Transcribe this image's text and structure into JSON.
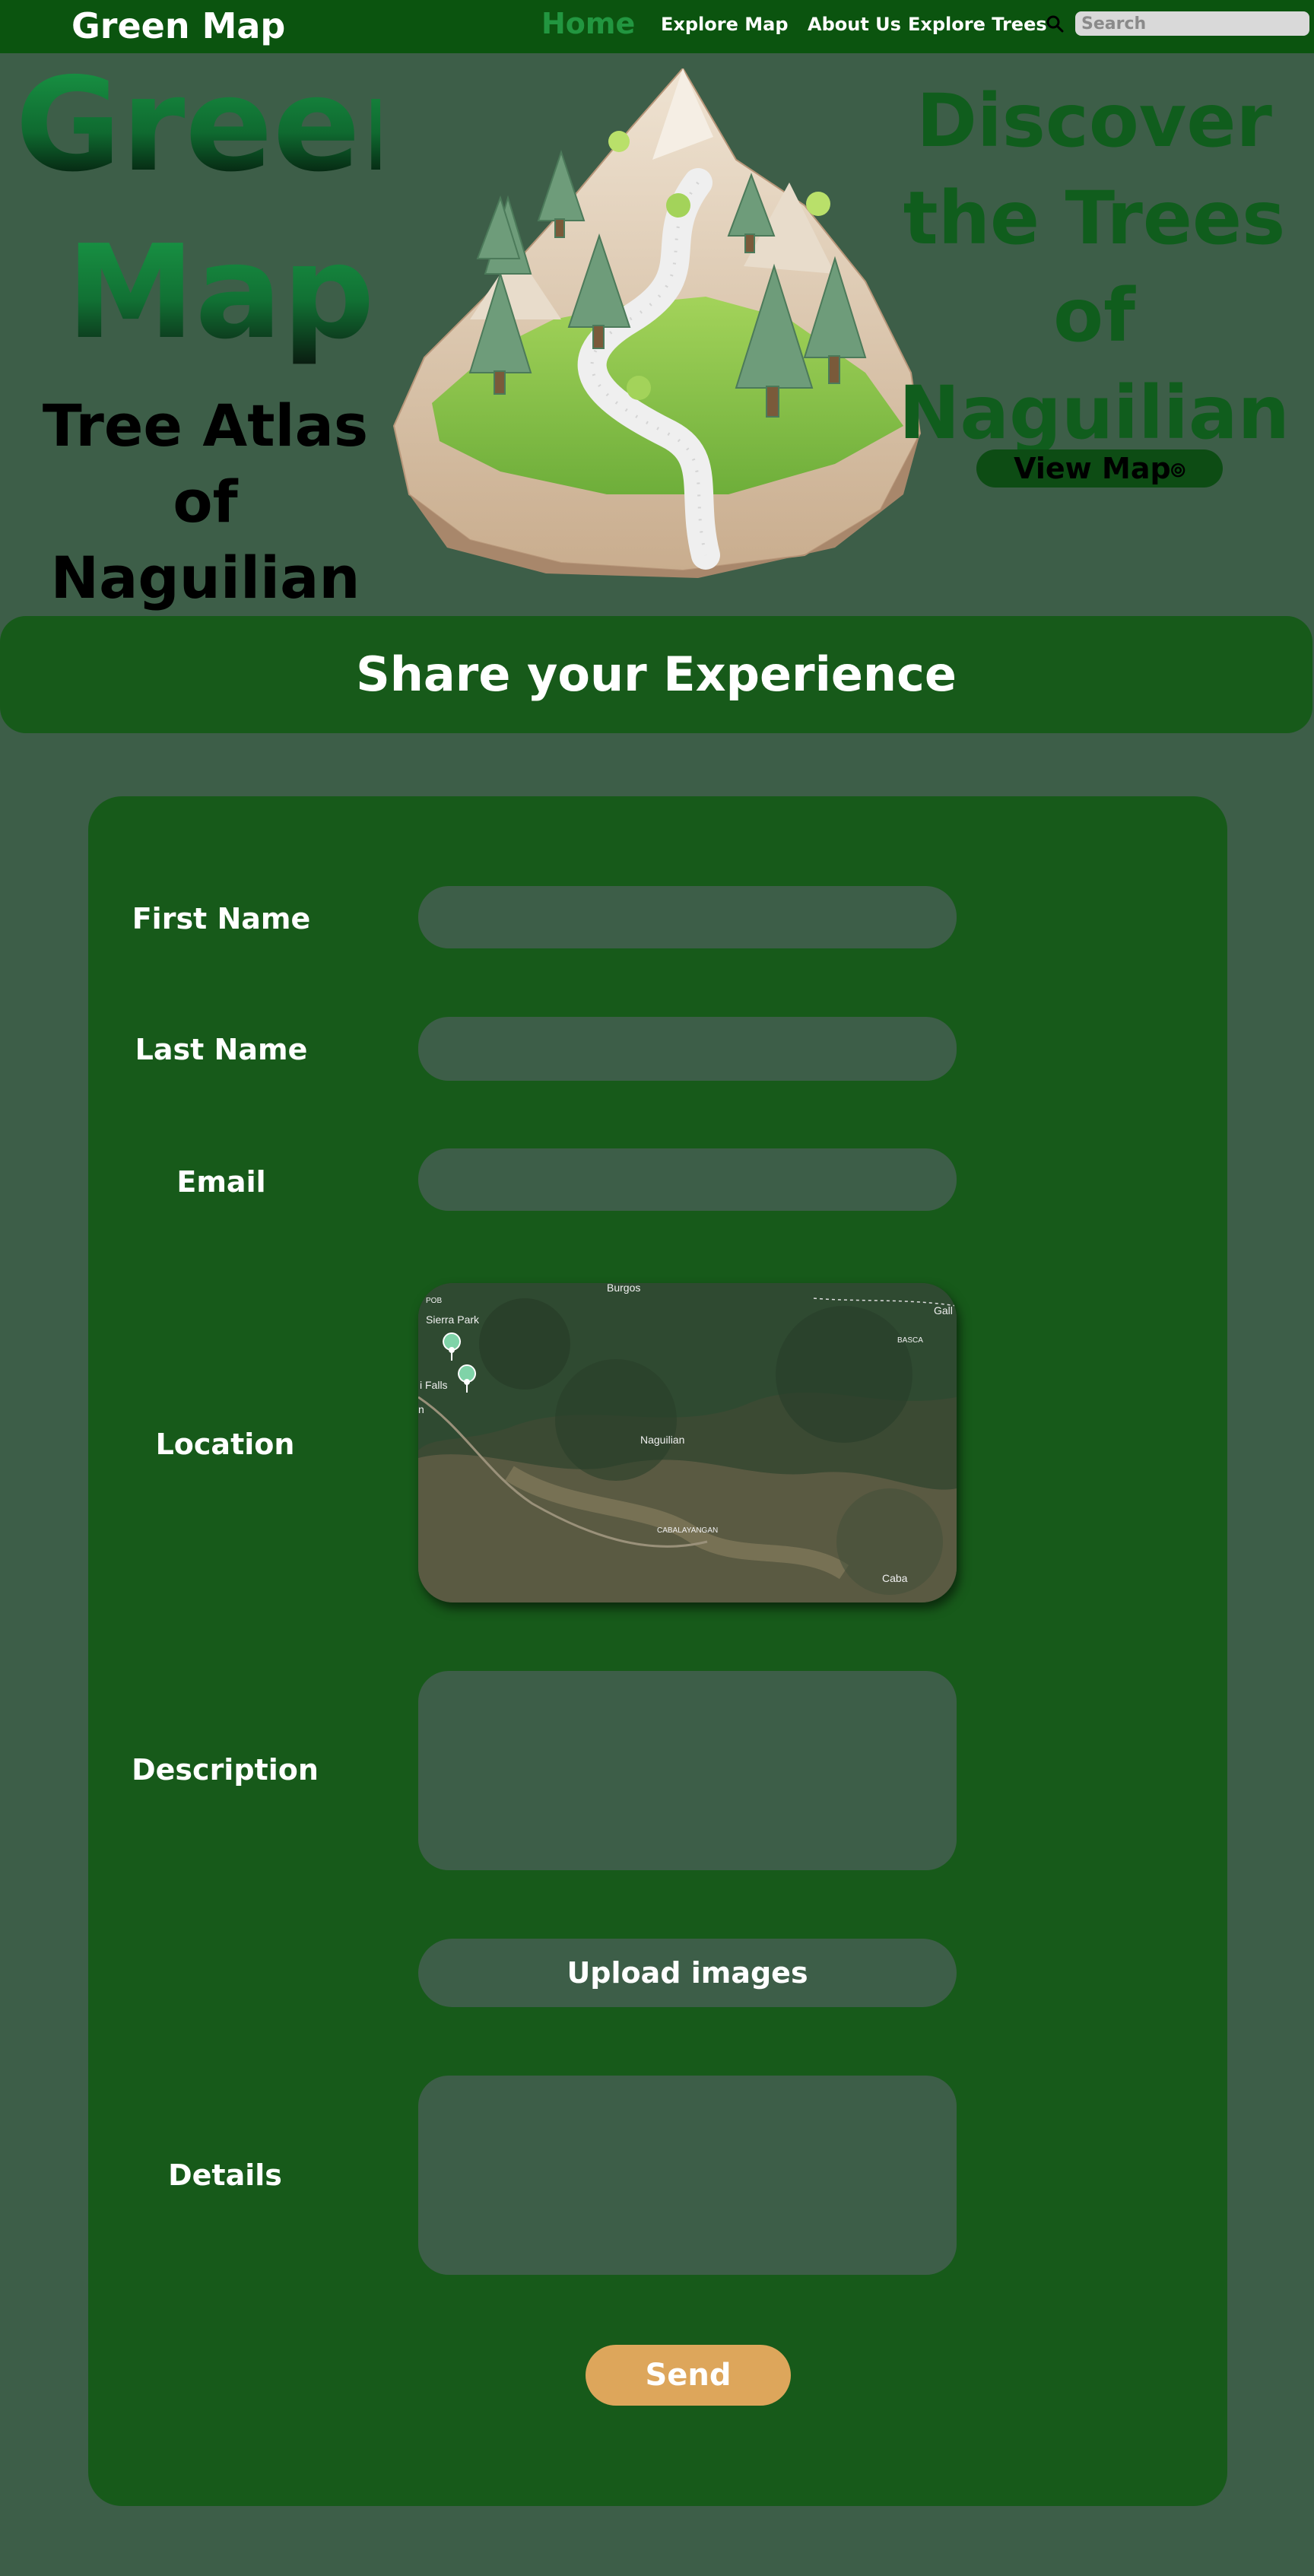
{
  "nav": {
    "brand": "Green Map",
    "home": "Home",
    "explore_map": "Explore Map",
    "about_us": "About Us",
    "explore_trees": "Explore Trees",
    "search_placeholder": "Search",
    "search_icon": "search-icon"
  },
  "hero": {
    "title_line1": "Green",
    "title_line2": "Map",
    "subtitle": "Tree Atlas of Naguilian",
    "discover": "Discover the Trees of Naguilian",
    "view_map_label": "View Map",
    "view_map_icon": "⦾"
  },
  "share": {
    "title": "Share your Experience"
  },
  "form": {
    "first_name_label": "First Name",
    "last_name_label": "Last Name",
    "email_label": "Email",
    "location_label": "Location",
    "description_label": "Description",
    "upload_label": "Upload images",
    "details_label": "Details",
    "send_label": "Send",
    "map_labels": {
      "burgos": "Burgos",
      "pob": "POB",
      "sierra_park": "Sierra Park",
      "falls": "i Falls",
      "n": "n",
      "gall": "Gall",
      "basca": "BASCA",
      "naguilian": "Naguilian",
      "cabalayangan": "CABALAYANGAN",
      "caba": "Caba"
    }
  },
  "colors": {
    "page_bg": "#3d5e48",
    "nav_bg": "#0b540f",
    "card_bg": "#175a1a",
    "field_bg": "#3d5e48",
    "accent_home": "#229640",
    "send_button": "#dda65b"
  }
}
